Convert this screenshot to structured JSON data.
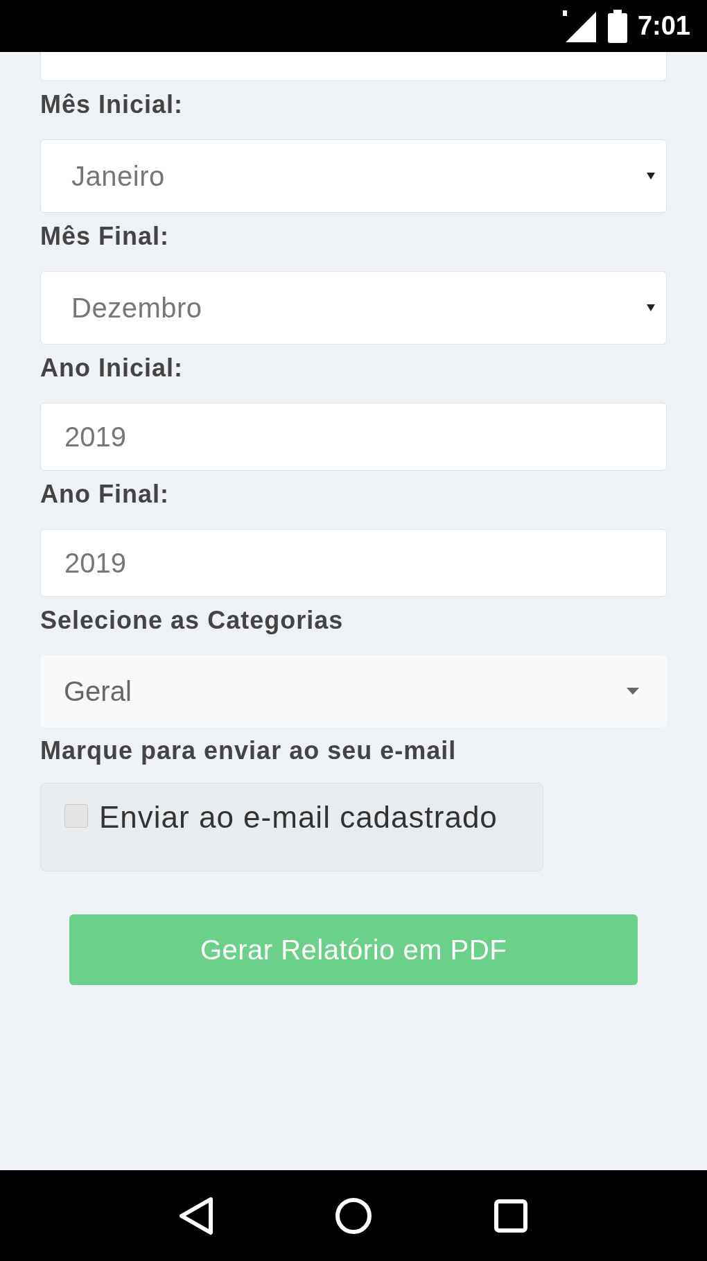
{
  "status_bar": {
    "time": "7:01"
  },
  "fields": [
    {
      "kind": "select",
      "label": "Mês Inicial:",
      "value": "Janeiro"
    },
    {
      "kind": "select",
      "label": "Mês Final:",
      "value": "Dezembro"
    },
    {
      "kind": "input",
      "label": "Ano Inicial:",
      "value": "2019"
    },
    {
      "kind": "input",
      "label": "Ano Final:",
      "value": "2019"
    },
    {
      "kind": "dropdown",
      "label": "Selecione as Categorias",
      "value": "Geral"
    }
  ],
  "email": {
    "label": "Marque para enviar ao seu e-mail",
    "checkbox_label": "Enviar ao e-mail cadastrado",
    "checked": false
  },
  "submit_button": "Gerar Relatório em PDF"
}
